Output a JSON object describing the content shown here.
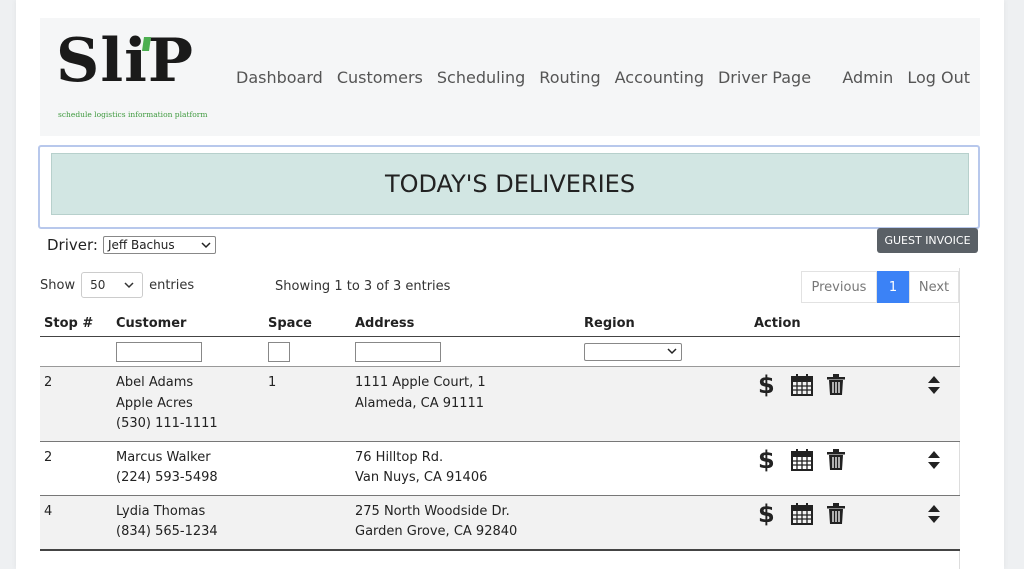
{
  "brand": {
    "logo_text": "SliP",
    "tagline": "schedule logistics information platform"
  },
  "nav": {
    "items": [
      "Dashboard",
      "Customers",
      "Scheduling",
      "Routing",
      "Accounting",
      "Driver Page"
    ],
    "right": [
      "Admin",
      "Log Out"
    ]
  },
  "banner": {
    "title": "TODAY'S DELIVERIES"
  },
  "driver": {
    "label": "Driver:",
    "selected": "Jeff Bachus"
  },
  "guest_invoice_label": "GUEST INVOICE",
  "table_controls": {
    "show_label": "Show",
    "length_value": "50",
    "entries_label": "entries",
    "info": "Showing 1 to 3 of 3 entries",
    "prev_label": "Previous",
    "current_page": "1",
    "next_label": "Next"
  },
  "columns": [
    "Stop #",
    "Customer",
    "Space",
    "Address",
    "Region",
    "Action"
  ],
  "rows": [
    {
      "stop": "2",
      "customer": [
        "Abel Adams",
        "Apple Acres",
        "(530) 111-1111"
      ],
      "space": "1",
      "address": [
        "1111 Apple Court, 1",
        "Alameda, CA 91111"
      ],
      "region": ""
    },
    {
      "stop": "2",
      "customer": [
        "Marcus Walker",
        "(224) 593-5498"
      ],
      "space": "",
      "address": [
        "76 Hilltop Rd.",
        "Van Nuys, CA 91406"
      ],
      "region": ""
    },
    {
      "stop": "4",
      "customer": [
        "Lydia Thomas",
        "(834) 565-1234"
      ],
      "space": "",
      "address": [
        "275 North Woodside Dr.",
        "Garden Grove, CA 92840"
      ],
      "region": ""
    }
  ],
  "icons": {
    "invoice": "$",
    "schedule": "calendar-icon",
    "delete": "trash-icon",
    "reorder": "sort-icon",
    "dropdown": "chevron-down-icon"
  },
  "colors": {
    "banner_bg": "#d2e6e3",
    "active_page": "#3b82f6",
    "logo_green": "#4caf50",
    "guest_button": "#5a6066"
  }
}
